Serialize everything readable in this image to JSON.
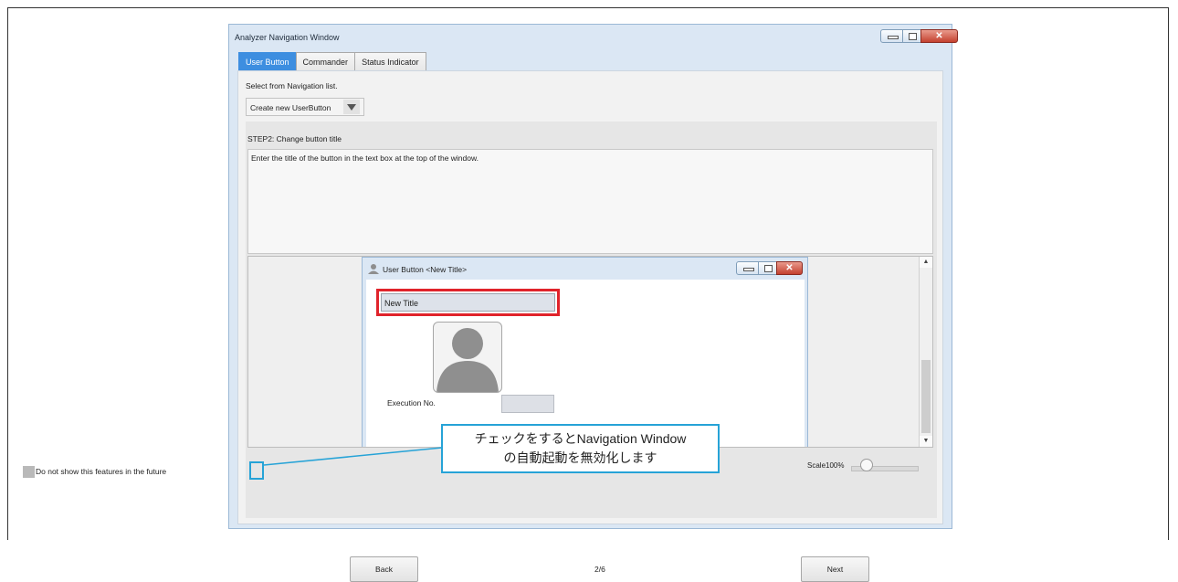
{
  "window": {
    "title": "Analyzer Navigation Window"
  },
  "tabs": [
    {
      "label": "User Button",
      "active": true
    },
    {
      "label": "Commander",
      "active": false
    },
    {
      "label": "Status Indicator",
      "active": false
    }
  ],
  "navigation": {
    "select_label": "Select from Navigation list.",
    "dropdown_value": "Create new UserButton"
  },
  "step": {
    "title": "STEP2: Change button title",
    "description": "Enter the title of the button in the text box at the top of the window."
  },
  "preview": {
    "window_title": "User Button <New Title>",
    "title_input_value": "New Title",
    "execution_label": "Execution No.",
    "scale_label": "Scale100%",
    "scale_value": 100
  },
  "footer": {
    "checkbox_label": "Do not show this features in the future",
    "checkbox_checked": false,
    "back_label": "Back",
    "page_indicator": "2/6",
    "next_label": "Next"
  },
  "callout": {
    "line1": "チェックをするとNavigation Window",
    "line2": "の自動起動を無効化します"
  },
  "colors": {
    "active_tab": "#3d8ee0",
    "highlight_red": "#e0232b",
    "callout_blue": "#26a3d7"
  }
}
